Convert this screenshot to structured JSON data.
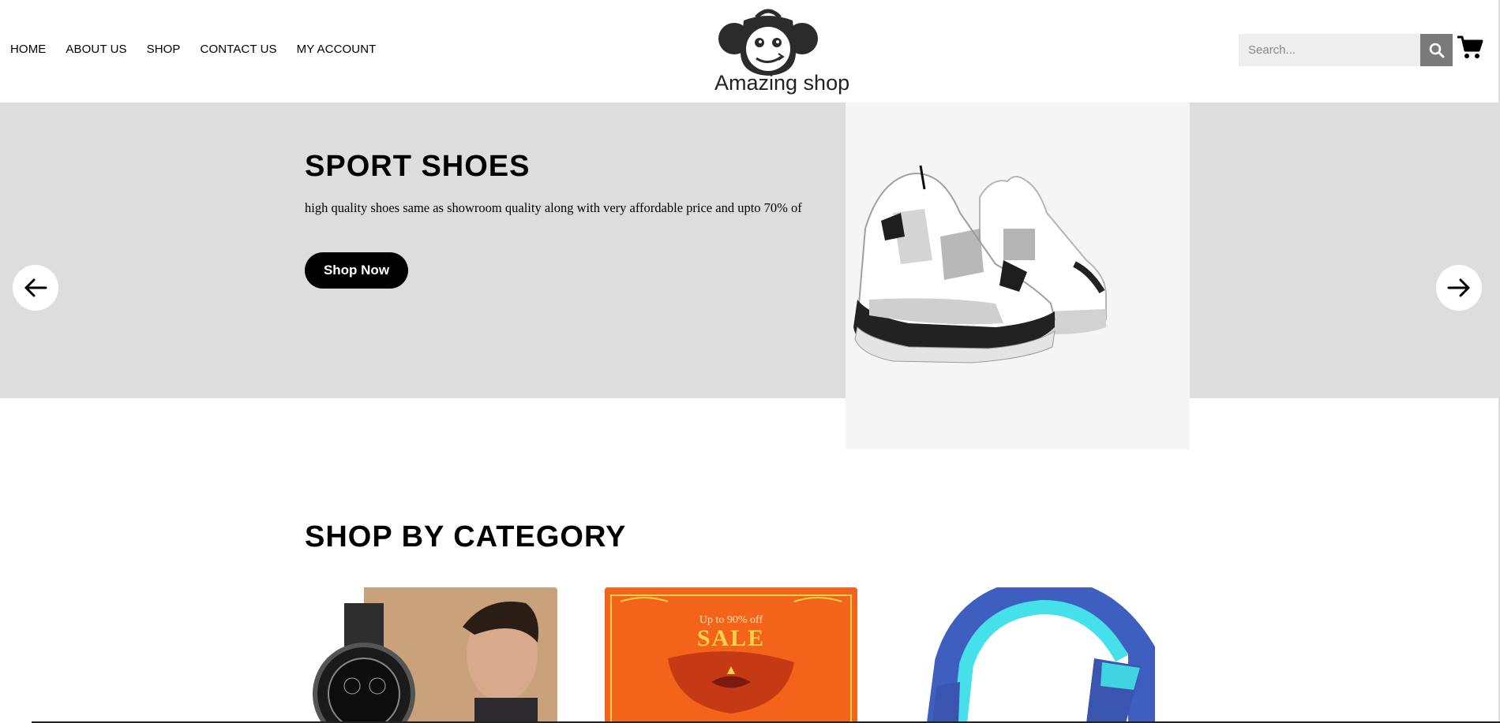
{
  "nav": {
    "items": [
      {
        "label": "HOME"
      },
      {
        "label": "ABOUT US"
      },
      {
        "label": "SHOP"
      },
      {
        "label": "CONTACT US"
      },
      {
        "label": "MY ACCOUNT"
      }
    ]
  },
  "brand": {
    "name": "Amazing shop",
    "logo_icon": "shopping-bag-face-icon"
  },
  "search": {
    "placeholder": "Search...",
    "value": "",
    "button_icon": "search-icon"
  },
  "cart": {
    "icon": "cart-icon"
  },
  "hero": {
    "title": "SPORT SHOES",
    "description": "high quality shoes same as showroom quality along with very affordable price and upto 70% of",
    "cta_label": "Shop Now",
    "prev_icon": "arrow-left-icon",
    "next_icon": "arrow-right-icon",
    "image": "sneakers-image"
  },
  "category": {
    "title": "SHOP BY CATEGORY",
    "cards": [
      {
        "image": "watch-man-image"
      },
      {
        "image": "sale-banner-image",
        "line1": "Up to 90% off",
        "line2": "SALE"
      },
      {
        "image": "headphones-image"
      }
    ]
  },
  "colors": {
    "hero_bg": "#dddddd",
    "accent": "#000000",
    "search_button": "#7a7a7a",
    "sale_orange": "#f3641a"
  }
}
